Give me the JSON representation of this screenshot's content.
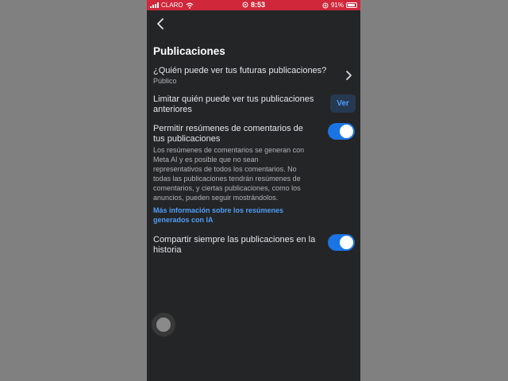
{
  "status_bar": {
    "carrier": "CLARO",
    "time": "8:53",
    "battery": "91%"
  },
  "header": {
    "back_icon": "chevron-left-icon"
  },
  "section": {
    "title": "Publicaciones"
  },
  "future_posts": {
    "label": "¿Quién puede ver tus futuras publicaciones?",
    "value": "Público",
    "icon": "chevron-right-icon"
  },
  "limit_past": {
    "label_line1": "Limitar quién puede ver tus publicaciones",
    "label_line2": "anteriores",
    "button_label": "Ver"
  },
  "comment_summaries": {
    "label_line1": "Permitir resúmenes de comentarios de",
    "label_line2": "tus publicaciones",
    "enabled": true,
    "desc_lines": [
      "Los resúmenes de comentarios se generan con",
      "Meta AI y es posible que no sean",
      "representativos de todos los comentarios. No",
      "todas las publicaciones tendrán resúmenes de",
      "comentarios, y ciertas publicaciones, como los",
      "anuncios, pueden seguir mostrándolos."
    ],
    "link_line1": "Más información sobre los resúmenes",
    "link_line2": "generados con IA"
  },
  "share_story": {
    "label_line1": "Compartir siempre las publicaciones en la",
    "label_line2": "historia",
    "enabled": true
  },
  "colors": {
    "accent": "#1b74e4",
    "status_bar": "#d0283a",
    "background": "#242526",
    "link": "#4f9ef7"
  }
}
